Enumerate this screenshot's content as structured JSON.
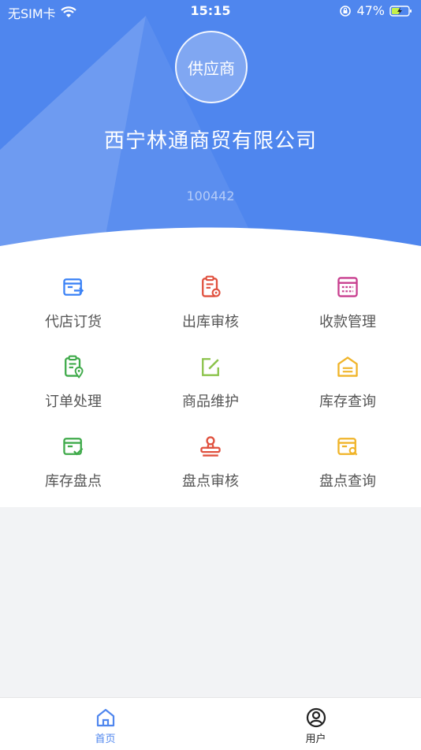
{
  "status_bar": {
    "carrier": "无SIM卡",
    "time": "15:15",
    "battery": "47%"
  },
  "profile": {
    "avatar_text": "供应商",
    "company_name": "西宁林通商贸有限公司",
    "code": "100442"
  },
  "menu": [
    {
      "label": "代店订货",
      "icon": "store-order-icon",
      "color": "#3b82f6"
    },
    {
      "label": "出库审核",
      "icon": "outbound-audit-icon",
      "color": "#e0513f"
    },
    {
      "label": "收款管理",
      "icon": "payment-management-icon",
      "color": "#c83f8f"
    },
    {
      "label": "订单处理",
      "icon": "order-process-icon",
      "color": "#3faa4a"
    },
    {
      "label": "商品维护",
      "icon": "product-edit-icon",
      "color": "#8bc34a"
    },
    {
      "label": "库存查询",
      "icon": "inventory-query-icon",
      "color": "#f0b429"
    },
    {
      "label": "库存盘点",
      "icon": "stocktake-icon",
      "color": "#3faa4a"
    },
    {
      "label": "盘点审核",
      "icon": "stocktake-audit-icon",
      "color": "#e0513f"
    },
    {
      "label": "盘点查询",
      "icon": "stocktake-query-icon",
      "color": "#f0b429"
    }
  ],
  "tabbar": {
    "home_label": "首页",
    "user_label": "用户",
    "active_color": "#4f86ee",
    "inactive_color": "#222222"
  }
}
